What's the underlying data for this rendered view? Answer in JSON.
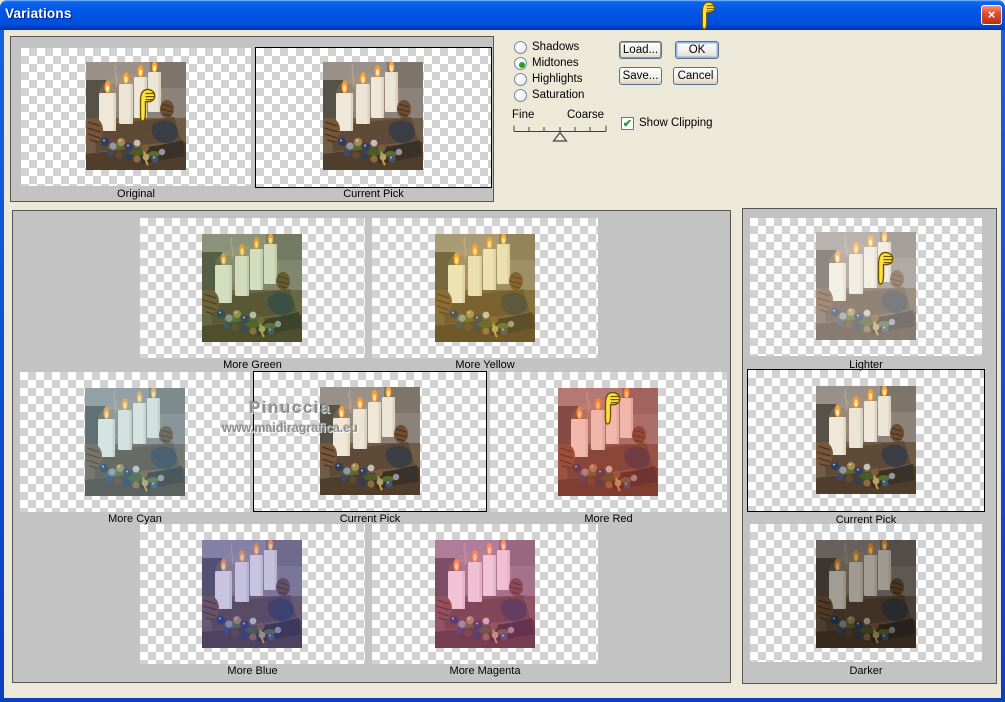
{
  "window": {
    "title": "Variations"
  },
  "icons": {
    "close": "×",
    "check": "✔"
  },
  "top_panel": {
    "items": [
      {
        "label": "Original"
      },
      {
        "label": "Current Pick"
      }
    ]
  },
  "main_panel": {
    "items": [
      {
        "label": "More Green"
      },
      {
        "label": "More Yellow"
      },
      {
        "label": "More Cyan"
      },
      {
        "label": "Current Pick"
      },
      {
        "label": "More Red"
      },
      {
        "label": "More Blue"
      },
      {
        "label": "More Magenta"
      }
    ]
  },
  "right_panel": {
    "items": [
      {
        "label": "Lighter"
      },
      {
        "label": "Current Pick"
      },
      {
        "label": "Darker"
      }
    ]
  },
  "controls": {
    "radios": [
      {
        "label": "Shadows",
        "selected": false
      },
      {
        "label": "Midtones",
        "selected": true
      },
      {
        "label": "Highlights",
        "selected": false
      },
      {
        "label": "Saturation",
        "selected": false
      }
    ],
    "buttons": {
      "load": "Load...",
      "save": "Save...",
      "ok": "OK",
      "cancel": "Cancel"
    },
    "slider": {
      "left_label": "Fine",
      "right_label": "Coarse",
      "position": "center"
    },
    "show_clipping": {
      "label": "Show Clipping",
      "checked": true
    }
  },
  "watermark": {
    "line1": "Pinuccia",
    "line2": "www.maidiragrafica.eu"
  },
  "colors": {
    "titlebar_blue": "#0054E3",
    "dialog_bg": "#ECE9D8",
    "panel_gray": "#C3C3C3",
    "selection_green": "#21A121",
    "close_red": "#D64430",
    "tints": {
      "none": "rgba(0,0,0,0)",
      "more_green": "rgba(70,170,60,0.16)",
      "more_yellow": "rgba(235,200,30,0.20)",
      "more_cyan": "rgba(130,215,255,0.24)",
      "more_red": "rgba(255,60,60,0.28)",
      "more_blue": "rgba(70,80,255,0.24)",
      "more_magenta": "rgba(255,60,210,0.22)",
      "lighter": "rgba(255,255,255,0.32)",
      "darker": "rgba(0,0,0,0.32)"
    }
  }
}
